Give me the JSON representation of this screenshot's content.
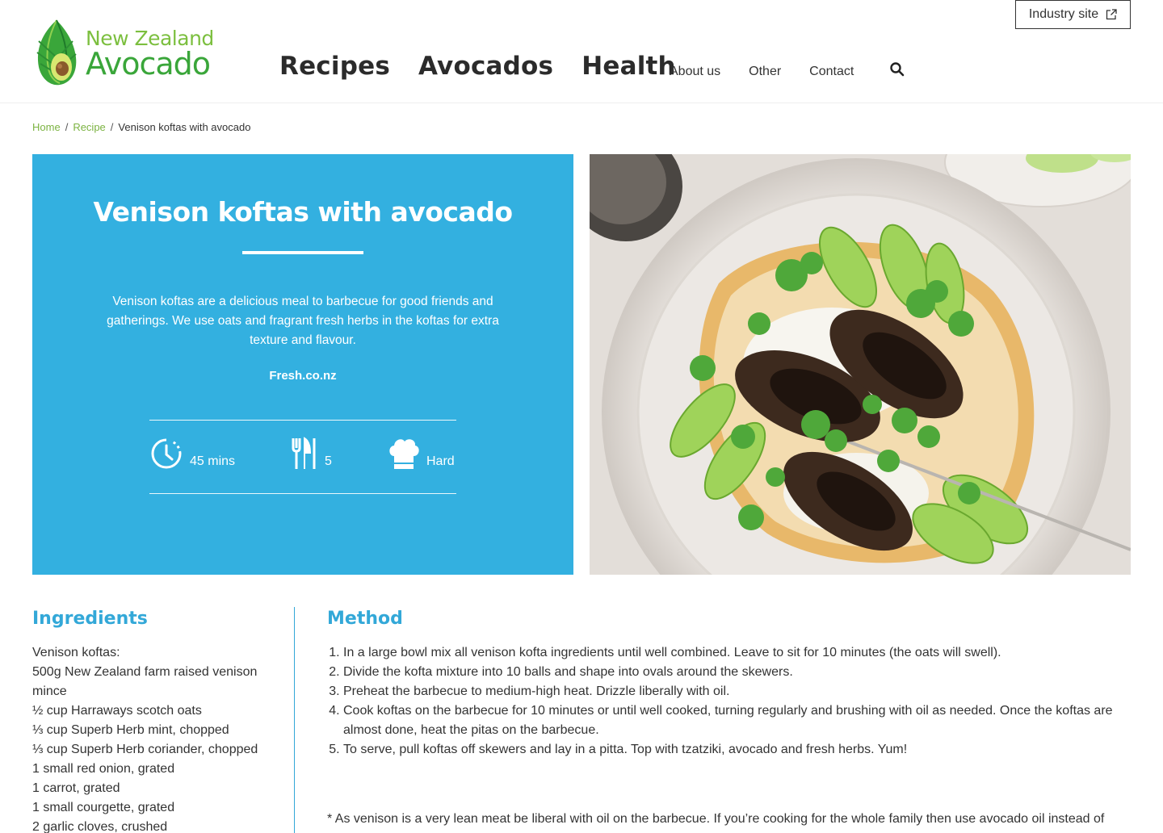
{
  "brand": {
    "line1": "New Zealand",
    "line2": "Avocado"
  },
  "nav": {
    "main": [
      "Recipes",
      "Avocados",
      "Health"
    ],
    "secondary": [
      "About us",
      "Other",
      "Contact"
    ],
    "industry_label": "Industry site"
  },
  "breadcrumb": {
    "home": "Home",
    "recipe": "Recipe",
    "current": "Venison koftas with avocado"
  },
  "hero": {
    "title": "Venison koftas with avocado",
    "description": "Venison koftas are a delicious meal to barbecue for good friends and gatherings. We use oats and fragrant fresh herbs in the koftas for extra texture and flavour.",
    "source": "Fresh.co.nz",
    "time": "45 mins",
    "serves": "5",
    "difficulty": "Hard"
  },
  "ingredients": {
    "title": "Ingredients",
    "items": [
      "Venison koftas:",
      "500g New Zealand farm raised venison mince",
      "½ cup Harraways scotch oats",
      "⅓ cup Superb Herb mint, chopped",
      "⅓ cup Superb Herb coriander, chopped",
      "1 small red onion, grated",
      "1 carrot, grated",
      "1 small courgette, grated",
      "2 garlic cloves, crushed"
    ]
  },
  "method": {
    "title": "Method",
    "steps": [
      "In a large bowl mix all venison kofta ingredients until well combined. Leave to sit for 10 minutes (the oats will swell).",
      "Divide the kofta mixture into 10 balls and shape into ovals around the skewers.",
      "Preheat the barbecue to medium-high heat. Drizzle liberally with oil.",
      "Cook koftas on the barbecue for 10 minutes or until well cooked, turning regularly and brushing with oil as needed. Once the koftas are almost done, heat the pitas on the barbecue.",
      "To serve, pull koftas off skewers and lay in a pitta. Top with tzatziki, avocado and fresh herbs. Yum!"
    ],
    "note": "* As venison is a very lean meat be liberal with oil on the barbecue. If you’re cooking for the whole family then use avocado oil instead of"
  },
  "colors": {
    "accent_blue": "#33b0e0",
    "brand_green": "#3aa63a",
    "link_green": "#7cb342"
  }
}
